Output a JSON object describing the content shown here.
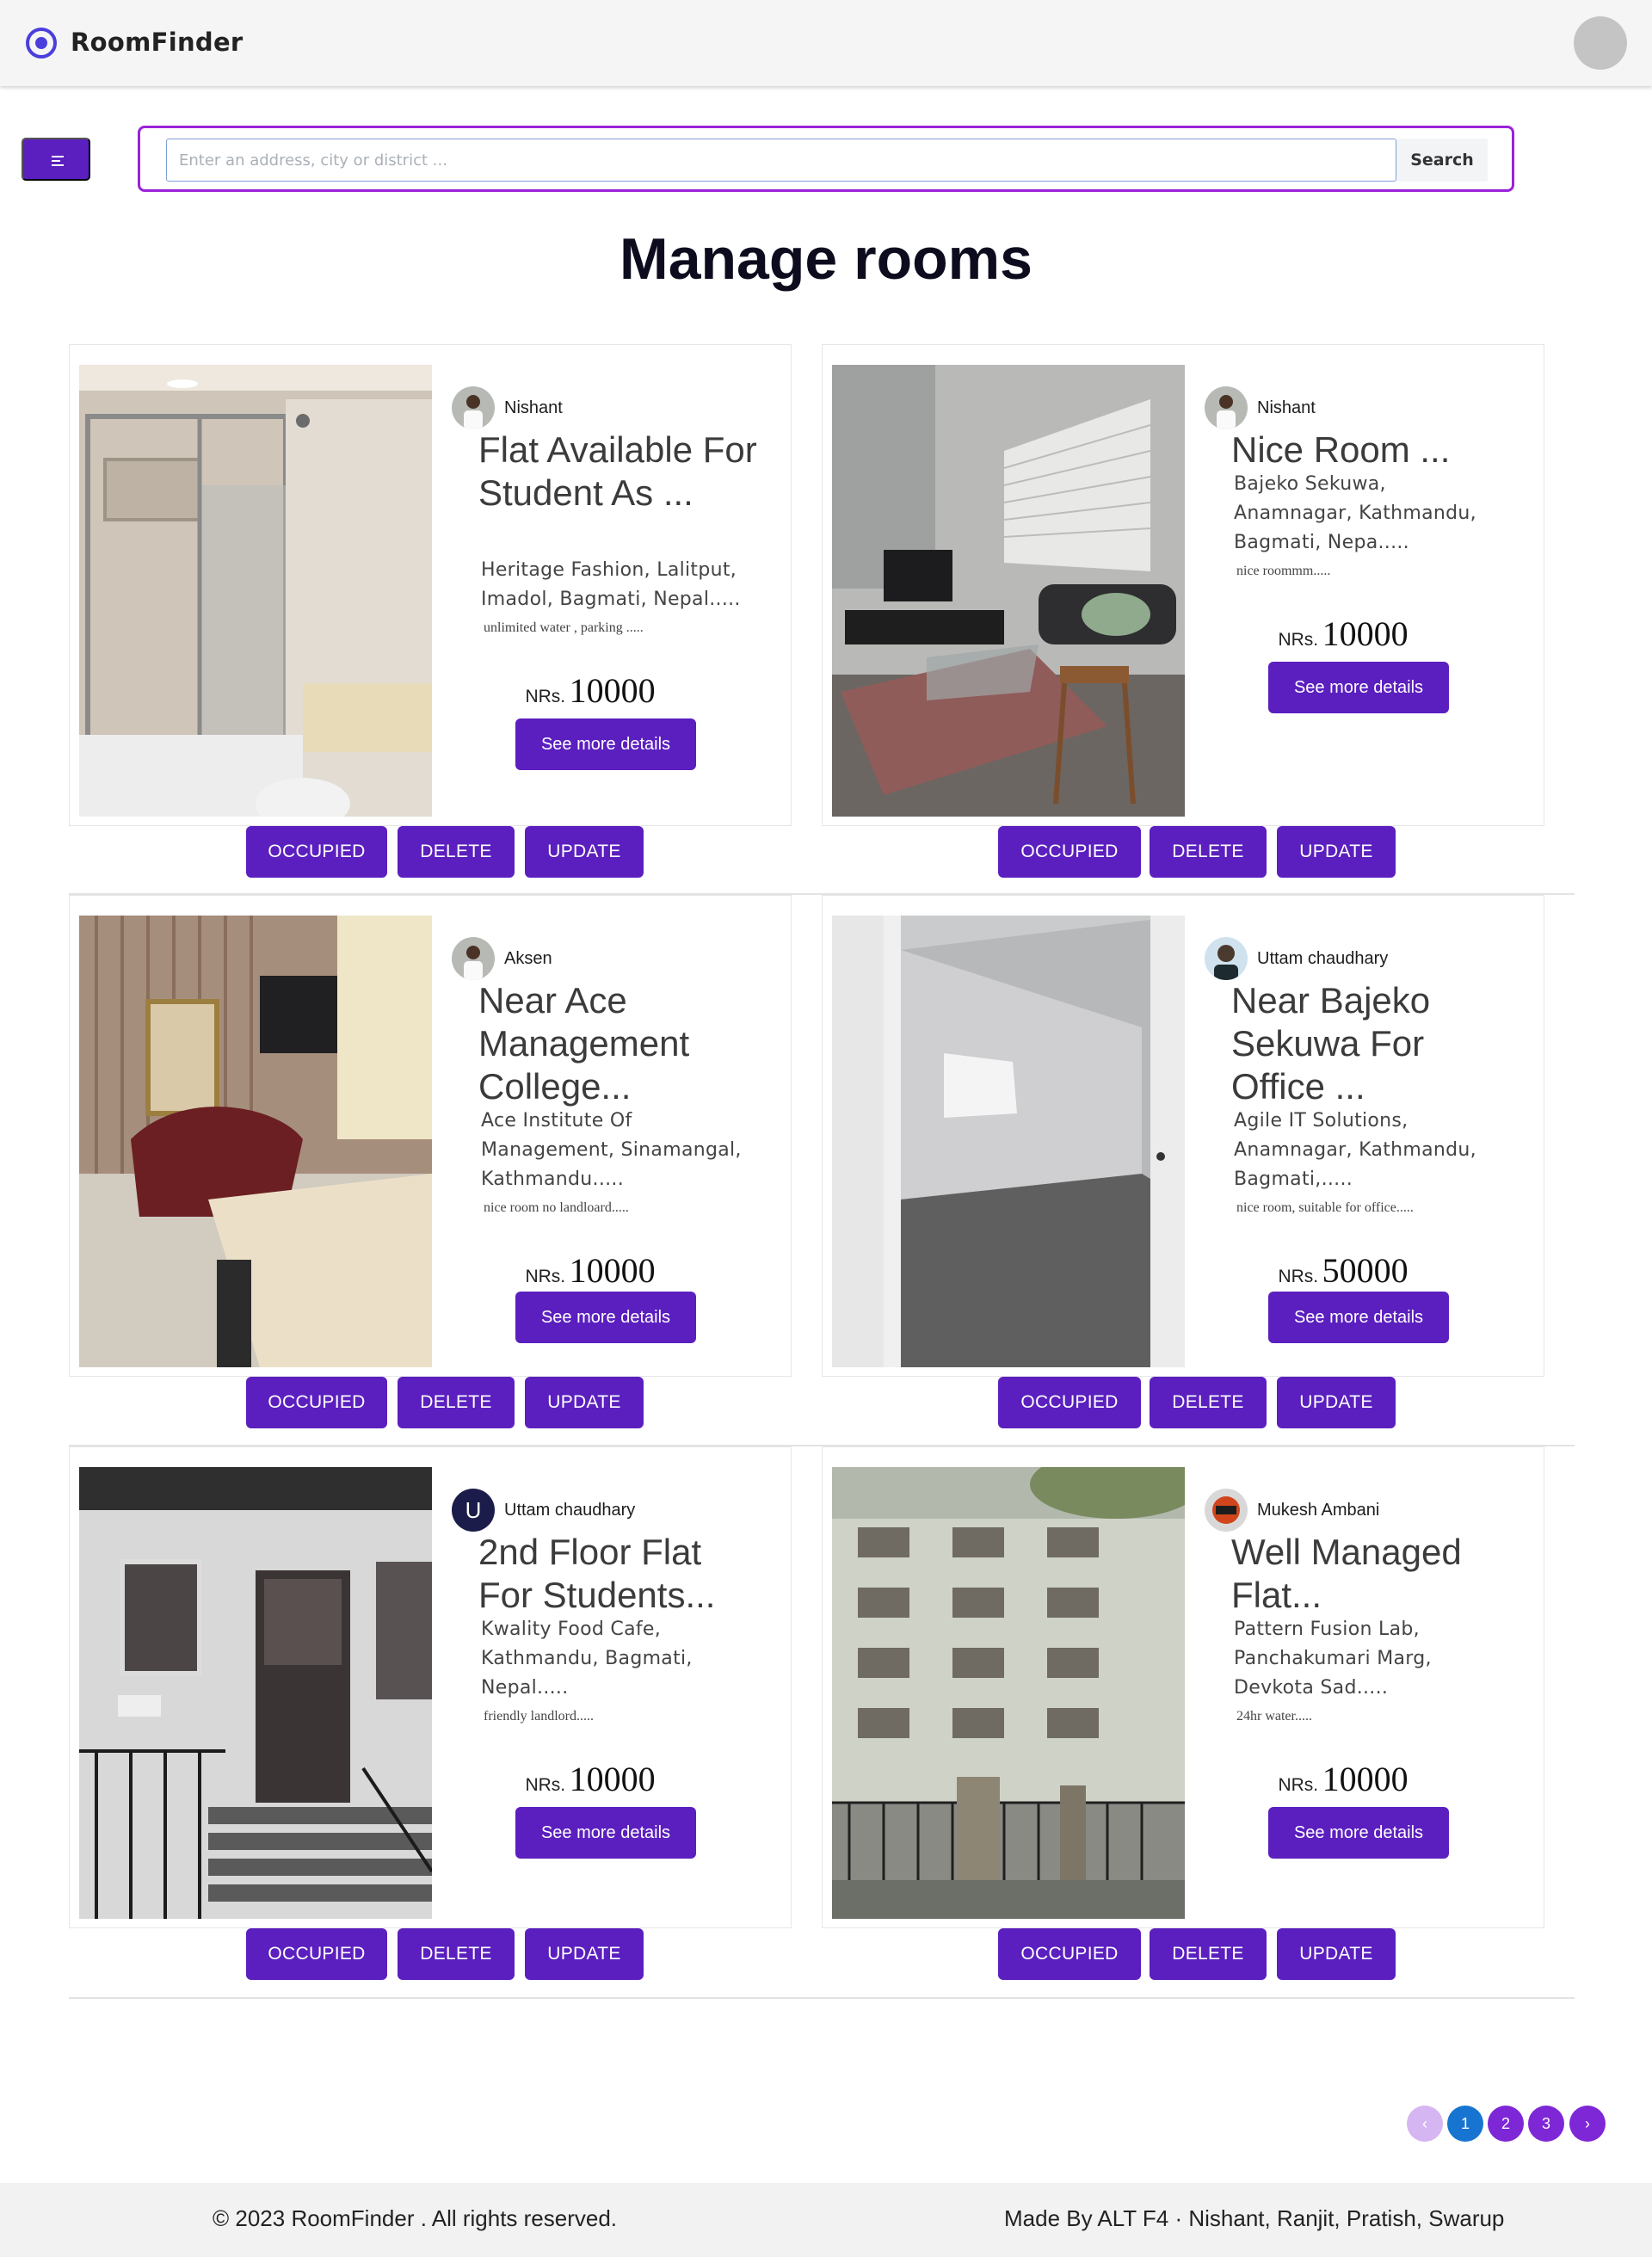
{
  "app": {
    "brand": "RoomFinder"
  },
  "search": {
    "placeholder": "Enter an address, city or district ...",
    "button_label": "Search"
  },
  "page": {
    "title": "Manage rooms"
  },
  "price_currency": "NRs.",
  "actions": {
    "occupied": "OCCUPIED",
    "delete": "DELETE",
    "update": "UPDATE",
    "details": "See more details"
  },
  "rooms": [
    {
      "owner": "Nishant",
      "title": "Flat Available For Student As ...",
      "address": "Heritage Fashion, Lalitput, Imadol, Bagmati, Nepal.....",
      "note": "unlimited water , parking .....",
      "price": "10000"
    },
    {
      "owner": "Nishant",
      "title": "Nice Room ...",
      "address": "Bajeko Sekuwa, Anamnagar, Kathmandu, Bagmati, Nepa.....",
      "note": "nice roommm.....",
      "price": "10000"
    },
    {
      "owner": "Aksen",
      "title": "Near Ace Management College...",
      "address": "Ace Institute Of Management, Sinamangal, Kathmandu.....",
      "note": "nice room no landloard.....",
      "price": "10000"
    },
    {
      "owner": "Uttam chaudhary",
      "title": "Near Bajeko Sekuwa For Office ...",
      "address": "Agile IT Solutions, Anamnagar, Kathmandu, Bagmati,.....",
      "note": "nice room, suitable for office.....",
      "price": "50000"
    },
    {
      "owner": "Uttam chaudhary",
      "owner_initial": "U",
      "title": "2nd Floor Flat For Students...",
      "address": "Kwality Food Cafe, Kathmandu, Bagmati, Nepal.....",
      "note": "friendly landlord.....",
      "price": "10000"
    },
    {
      "owner": "Mukesh Ambani",
      "title": "Well Managed Flat...",
      "address": "Pattern Fusion Lab, Panchakumari Marg, Devkota Sad.....",
      "note": "24hr water.....",
      "price": "10000"
    }
  ],
  "pagination": {
    "pages": [
      "1",
      "2",
      "3"
    ],
    "prev": "‹",
    "next": "›",
    "current": "1"
  },
  "footer": {
    "copyright": "© 2023 RoomFinder . All rights reserved.",
    "credits": "Made By ALT F4 · Nishant, Ranjit, Pratish, Swarup"
  },
  "colors": {
    "accent": "#5b1fbf",
    "search_border": "#9a22d8",
    "active_page": "#1774d1",
    "brand_icon": "#4a3fdc"
  }
}
